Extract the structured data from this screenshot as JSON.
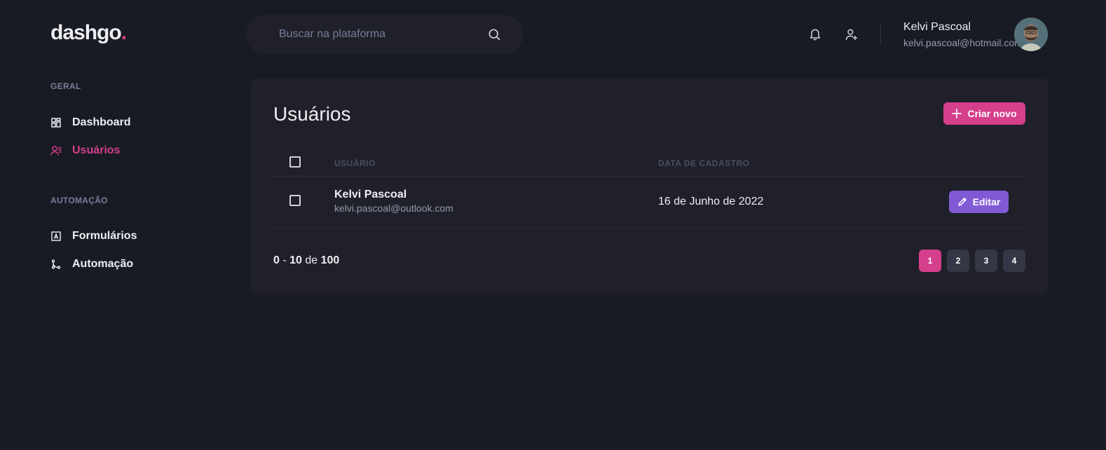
{
  "logo": {
    "text": "dashgo",
    "dot": "."
  },
  "search": {
    "placeholder": "Buscar na plataforma"
  },
  "profile": {
    "name": "Kelvi Pascoal",
    "email": "kelvi.pascoal@hotmail.com"
  },
  "sidebar": {
    "sections": [
      {
        "title": "GERAL",
        "items": [
          {
            "label": "Dashboard",
            "icon": "dashboard-icon"
          },
          {
            "label": "Usuários",
            "icon": "users-icon",
            "active": true
          }
        ]
      },
      {
        "title": "AUTOMAÇÃO",
        "items": [
          {
            "label": "Formulários",
            "icon": "form-icon"
          },
          {
            "label": "Automação",
            "icon": "git-merge-icon"
          }
        ]
      }
    ]
  },
  "main": {
    "title": "Usuários",
    "new_button": "Criar novo",
    "table": {
      "headers": [
        "USUÁRIO",
        "DATA DE CADASTRO"
      ],
      "rows": [
        {
          "name": "Kelvi Pascoal",
          "email": "kelvi.pascoal@outlook.com",
          "date": "16 de Junho de 2022",
          "edit_label": "Editar"
        }
      ]
    },
    "pagination": {
      "start": "0",
      "sep": " - ",
      "end": "10",
      "of": " de ",
      "total": "100",
      "pages": [
        "1",
        "2",
        "3",
        "4"
      ],
      "current": "1"
    }
  },
  "colors": {
    "accent": "#d53f8c",
    "purple": "#805ad5",
    "background": "#181b23",
    "card": "#1f2029"
  }
}
